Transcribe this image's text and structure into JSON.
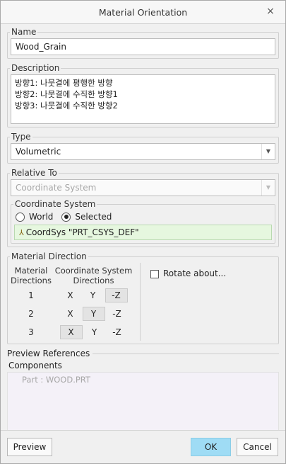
{
  "window": {
    "title": "Material Orientation",
    "close_glyph": "×"
  },
  "name": {
    "legend": "Name",
    "value": "Wood_Grain"
  },
  "description": {
    "legend": "Description",
    "lines": [
      "방향1: 나뭇결에 평행한 방향",
      "방향2: 나뭇결에 수직한 방향1",
      "방향3: 나뭇결에 수직한 방향2"
    ]
  },
  "type": {
    "legend": "Type",
    "value": "Volumetric"
  },
  "relative_to": {
    "legend": "Relative To",
    "value": "Coordinate System"
  },
  "coordinate_system": {
    "legend": "Coordinate System",
    "options": [
      "World",
      "Selected"
    ],
    "selected": "Selected",
    "selection_text": "CoordSys \"PRT_CSYS_DEF\""
  },
  "material_direction": {
    "legend": "Material Direction",
    "header_material": [
      "Material",
      "Directions"
    ],
    "header_coord": [
      "Coordinate System",
      "Directions"
    ],
    "rows": [
      {
        "num": "1",
        "axes": [
          "X",
          "Y",
          "-Z"
        ],
        "selected": "-Z"
      },
      {
        "num": "2",
        "axes": [
          "X",
          "Y",
          "-Z"
        ],
        "selected": "Y"
      },
      {
        "num": "3",
        "axes": [
          "X",
          "Y",
          "-Z"
        ],
        "selected": "X"
      }
    ],
    "rotate_label": "Rotate about...",
    "rotate_checked": false
  },
  "preview_references": {
    "legend": "Preview References",
    "components_label": "Components",
    "items": [
      "Part : WOOD.PRT"
    ]
  },
  "buttons": {
    "preview": "Preview",
    "ok": "OK",
    "cancel": "Cancel"
  },
  "colors": {
    "ok_button": "#9fdcf5",
    "selection_bg": "#e6f7df",
    "components_bg": "#f4f1f8"
  }
}
